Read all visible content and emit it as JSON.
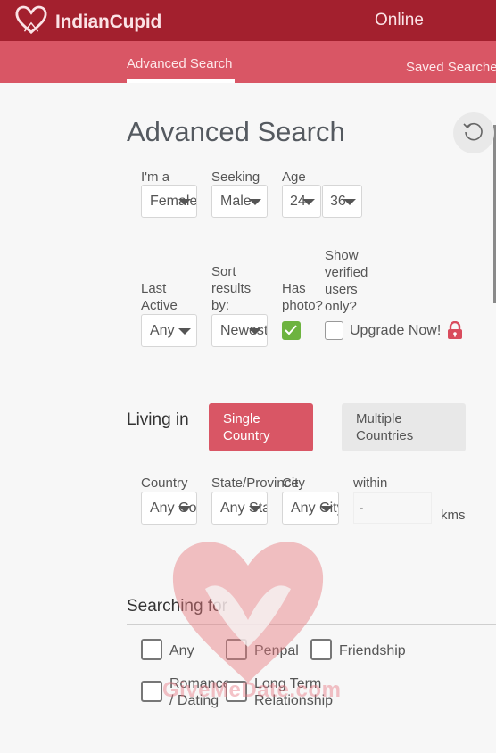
{
  "header": {
    "brand_name": "IndianCupid",
    "online_label": "Online"
  },
  "nav": {
    "tabs": [
      {
        "label": "Advanced Search",
        "active": true
      },
      {
        "label": "Saved Searches",
        "active": false
      }
    ]
  },
  "page": {
    "title": "Advanced Search",
    "reset_icon": "reset-icon"
  },
  "filters": {
    "im_a": {
      "label": "I'm a",
      "value": "Female"
    },
    "seeking": {
      "label": "Seeking",
      "value": "Male"
    },
    "age": {
      "label": "Age",
      "min": "24",
      "max": "36"
    },
    "last_active": {
      "label": "Last Active",
      "value": "Any"
    },
    "sort_by": {
      "label": "Sort results by:",
      "value": "Newest"
    },
    "has_photo": {
      "label": "Has photo?",
      "checked": true
    },
    "verified_only": {
      "label": "Show verified users only?",
      "checked": false,
      "option_label": "Upgrade Now!",
      "icon": "lock-icon"
    }
  },
  "living_in": {
    "label": "Living in",
    "options": [
      {
        "label": "Single Country",
        "active": true
      },
      {
        "label": "Multiple Countries",
        "active": false
      }
    ],
    "country": {
      "label": "Country",
      "value": "Any Country"
    },
    "state": {
      "label": "State/Province",
      "value": "Any State"
    },
    "city": {
      "label": "City",
      "value": "Any City"
    },
    "within": {
      "label": "within",
      "value": "-",
      "unit": "kms"
    }
  },
  "searching_for": {
    "label": "Searching for",
    "options": [
      {
        "label": "Any",
        "checked": false
      },
      {
        "label": "Penpal",
        "checked": false
      },
      {
        "label": "Friendship",
        "checked": false
      },
      {
        "label": "Romance / Dating",
        "checked": false
      },
      {
        "label": "Long Term Relationship",
        "checked": false
      }
    ]
  },
  "watermark": {
    "text": "GiveMeDate.com"
  },
  "colors": {
    "header_bg": "#a3202e",
    "subnav_bg": "#d95665",
    "accent": "#d95665",
    "checkbox_on": "#6db33f"
  }
}
